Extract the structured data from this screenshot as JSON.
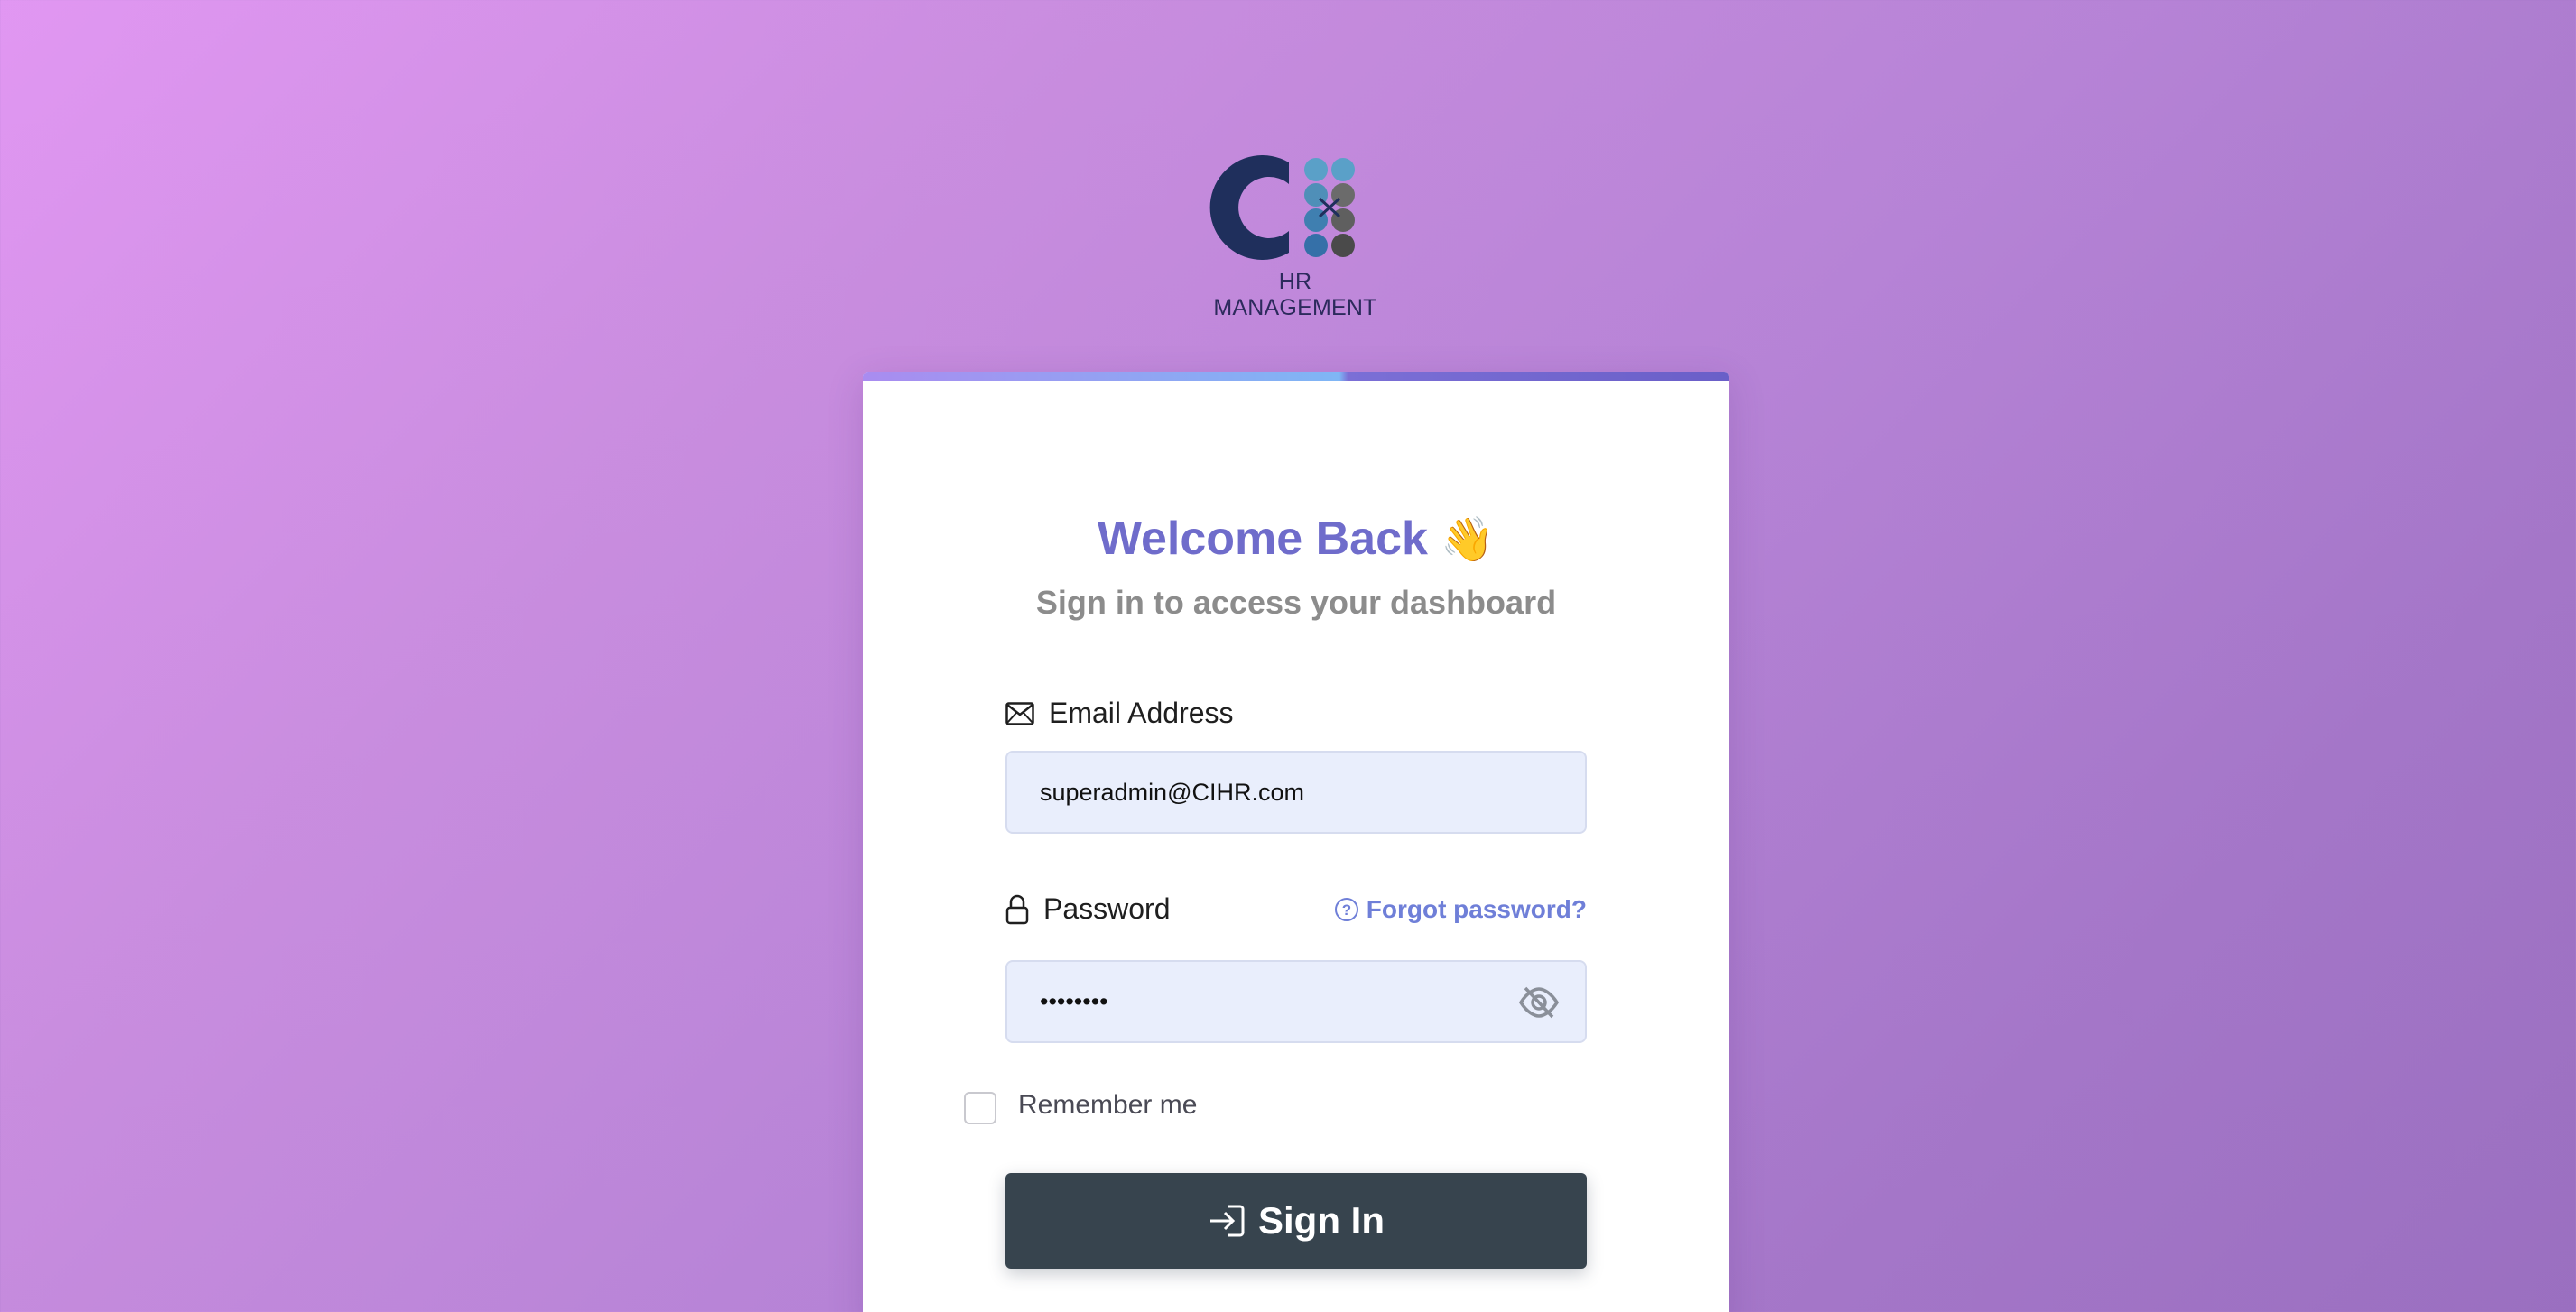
{
  "logo": {
    "caption": "HR MANAGEMENT",
    "icon": "cihr-logo"
  },
  "card": {
    "title": "Welcome Back",
    "title_emoji": "👋",
    "subtitle": "Sign in to access your dashboard"
  },
  "email": {
    "label": "Email Address",
    "icon": "envelope-icon",
    "value": "superadmin@CIHR.com"
  },
  "password": {
    "label": "Password",
    "icon": "lock-icon",
    "value": "••••••••",
    "visibility_icon": "eye-slash-icon"
  },
  "forgot": {
    "label": "Forgot password?",
    "icon": "question-circle-icon"
  },
  "remember": {
    "label": "Remember me",
    "checked": false
  },
  "signin": {
    "label": "Sign In",
    "icon": "sign-in-icon"
  },
  "colors": {
    "accent": "#6f6ccb",
    "button": "#37444e",
    "input_bg": "#e9eefc",
    "link": "#6f7fd8"
  }
}
